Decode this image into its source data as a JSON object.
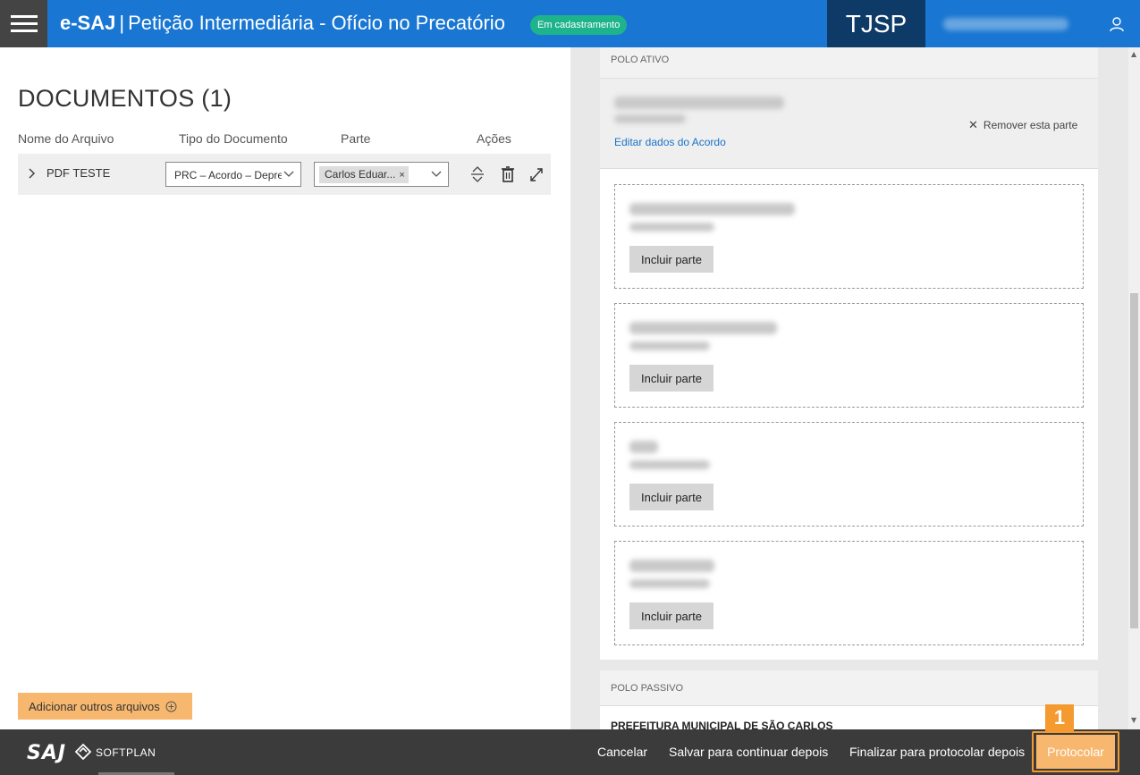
{
  "header": {
    "app_name": "e-SAJ",
    "separator": "|",
    "page_title": "Petição Intermediária - Ofício no Precatório",
    "status_badge": "Em cadastramento",
    "brand": "TJSP"
  },
  "documents": {
    "title": "DOCUMENTOS (1)",
    "columns": [
      "Nome do Arquivo",
      "Tipo do Documento",
      "Parte",
      "Ações"
    ],
    "rows": [
      {
        "file_name": "PDF TESTE",
        "doc_type": "PRC – Acordo – Depre",
        "party_chip": "Carlos Eduar...",
        "chip_remove": "×"
      }
    ],
    "add_button": "Adicionar outros arquivos"
  },
  "polo_ativo": {
    "label": "POLO ATIVO",
    "edit_link": "Editar dados do Acordo",
    "remove_link": "Remover esta parte",
    "include_label": "Incluir parte",
    "party_boxes": 4
  },
  "polo_passivo": {
    "label": "POLO PASSIVO",
    "first_party": "PREFEITURA MUNICIPAL DE SÃO CARLOS"
  },
  "footer": {
    "logo_saj": "SAJ",
    "logo_softplan": "SOFTPLAN",
    "cancel": "Cancelar",
    "save_later": "Salvar para continuar depois",
    "finalize": "Finalizar para protocolar depois",
    "submit": "Protocolar",
    "step_badge": "1"
  },
  "colors": {
    "header_blue": "#1976d2",
    "brand_navy": "#0d3a66",
    "status_green": "#1db38b",
    "accent_orange": "#f59a2f",
    "button_orange": "#f7b76e",
    "link_blue": "#1a73c8",
    "footer_dark": "#3b3b3b"
  }
}
